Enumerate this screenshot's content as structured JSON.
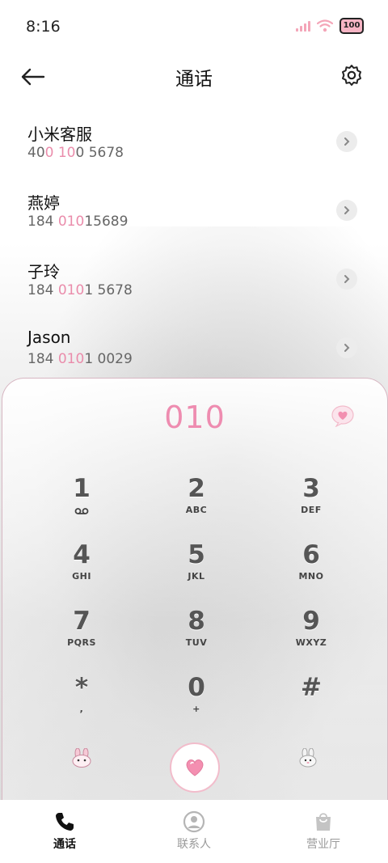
{
  "status_bar": {
    "time": "8:16",
    "battery": "100"
  },
  "header": {
    "title": "通话"
  },
  "recents": [
    {
      "name": "小米客服",
      "number_parts": [
        "40",
        "0 10",
        "0 5678"
      ]
    },
    {
      "name": "燕婷",
      "number_parts": [
        "184 ",
        "010",
        "15689"
      ]
    },
    {
      "name": "子玲",
      "number_parts": [
        "184 ",
        "010",
        "1 5678"
      ]
    },
    {
      "name": "Jason",
      "number_parts": [
        "184 ",
        "010",
        "1 0029"
      ]
    }
  ],
  "dialer": {
    "input": "010",
    "keys": [
      {
        "digit": "1",
        "letters": ""
      },
      {
        "digit": "2",
        "letters": "ABC"
      },
      {
        "digit": "3",
        "letters": "DEF"
      },
      {
        "digit": "4",
        "letters": "GHI"
      },
      {
        "digit": "5",
        "letters": "JKL"
      },
      {
        "digit": "6",
        "letters": "MNO"
      },
      {
        "digit": "7",
        "letters": "PQRS"
      },
      {
        "digit": "8",
        "letters": "TUV"
      },
      {
        "digit": "9",
        "letters": "WXYZ"
      },
      {
        "digit": "*",
        "letters": ","
      },
      {
        "digit": "0",
        "letters": "+"
      },
      {
        "digit": "#",
        "letters": ""
      }
    ]
  },
  "tabs": [
    {
      "label": "通话",
      "icon": "phone-icon",
      "active": true
    },
    {
      "label": "联系人",
      "icon": "contacts-icon",
      "active": false
    },
    {
      "label": "营业厅",
      "icon": "store-bag-icon",
      "active": false
    }
  ],
  "colors": {
    "accent_pink": "#ee8cb0",
    "highlight_pink": "#ea8cab"
  }
}
